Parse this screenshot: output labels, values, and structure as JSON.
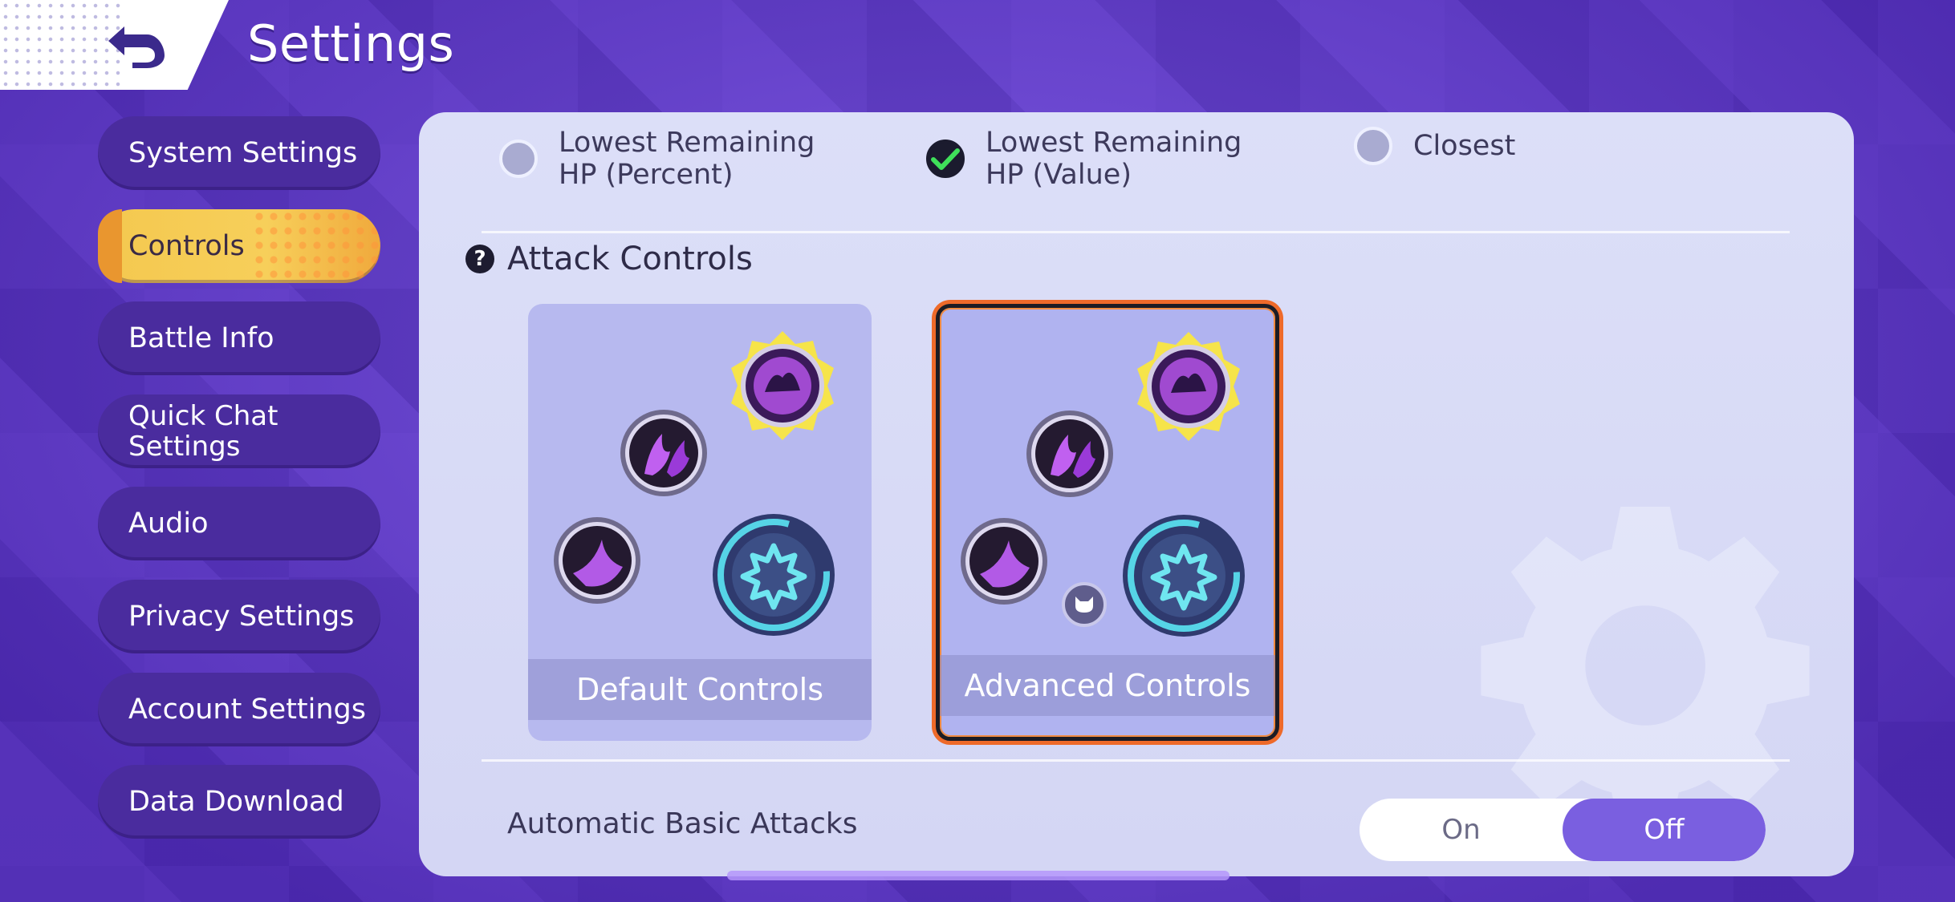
{
  "header": {
    "title": "Settings"
  },
  "sidebar": {
    "items": [
      {
        "label": "System Settings"
      },
      {
        "label": "Controls"
      },
      {
        "label": "Battle Info"
      },
      {
        "label": "Quick Chat Settings"
      },
      {
        "label": "Audio"
      },
      {
        "label": "Privacy Settings"
      },
      {
        "label": "Account Settings"
      },
      {
        "label": "Data Download"
      }
    ],
    "active_index": 1
  },
  "targeting": {
    "options": [
      {
        "label": "Lowest Remaining HP (Percent)",
        "checked": false
      },
      {
        "label": "Lowest Remaining HP (Value)",
        "checked": true
      },
      {
        "label": "Closest",
        "checked": false
      }
    ]
  },
  "attack_controls": {
    "title": "Attack Controls",
    "help_icon": "question-mark-icon",
    "cards": [
      {
        "label": "Default Controls",
        "selected": false
      },
      {
        "label": "Advanced Controls",
        "selected": true
      }
    ]
  },
  "auto_basic_attacks": {
    "label": "Automatic Basic Attacks",
    "on_label": "On",
    "off_label": "Off",
    "value": "Off"
  },
  "colors": {
    "background": "#5a36c4",
    "sidebar_item": "#4a2c9e",
    "sidebar_active": "#f4c84f",
    "panel": "#dcdff8",
    "toggle_active": "#7a5fe0",
    "selected_border": "#ee6a2a",
    "check_green": "#3fe05a"
  }
}
